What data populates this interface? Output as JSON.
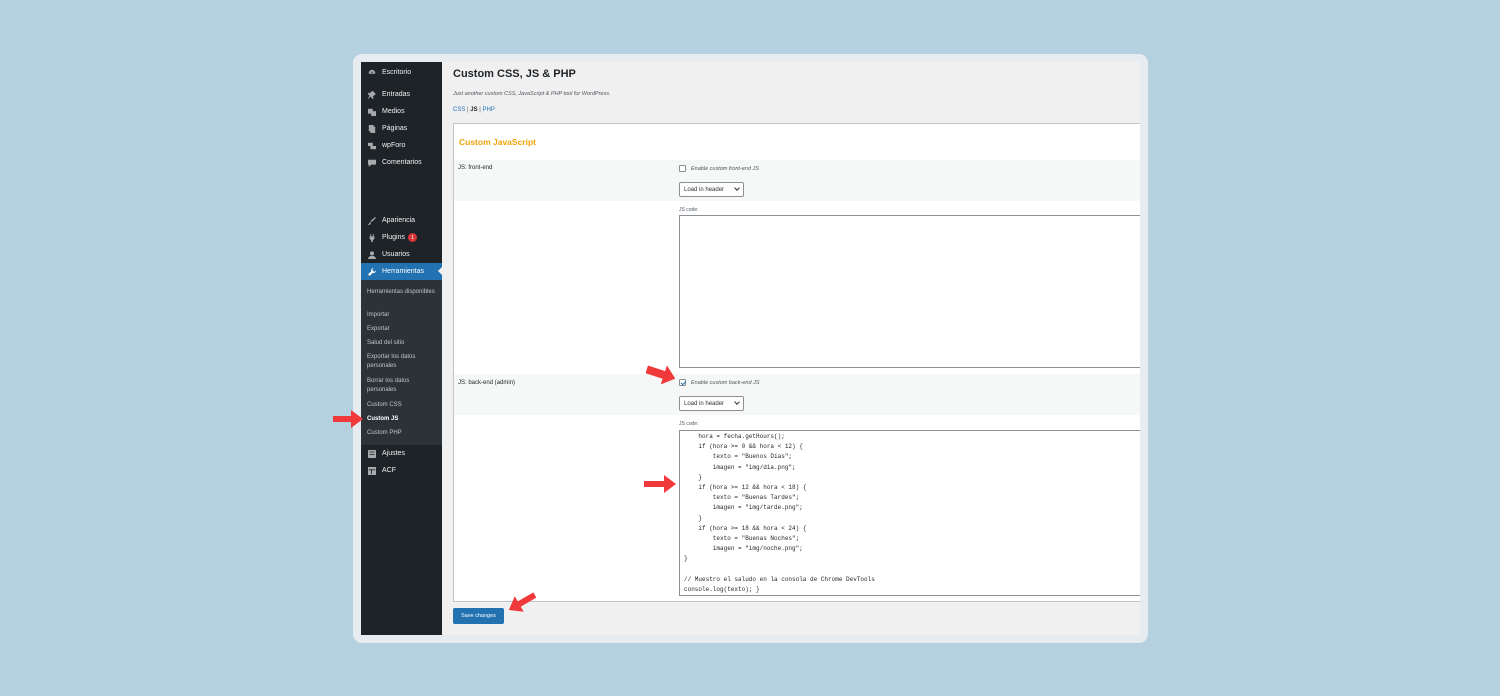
{
  "sidebar": {
    "items": [
      {
        "label": "Escritorio",
        "icon": "dashboard-icon"
      },
      {
        "label": "Entradas",
        "icon": "pin-icon"
      },
      {
        "label": "Medios",
        "icon": "media-icon"
      },
      {
        "label": "Páginas",
        "icon": "pages-icon"
      },
      {
        "label": "wpForo",
        "icon": "forum-icon"
      },
      {
        "label": "Comentarios",
        "icon": "comments-icon"
      },
      {
        "label": "Apariencia",
        "icon": "appearance-icon"
      },
      {
        "label": "Plugins",
        "icon": "plugins-icon",
        "badge": "1"
      },
      {
        "label": "Usuarios",
        "icon": "users-icon"
      },
      {
        "label": "Herramientas",
        "icon": "tools-icon"
      },
      {
        "label": "Ajustes",
        "icon": "settings-icon"
      },
      {
        "label": "ACF",
        "icon": "acf-icon"
      }
    ],
    "submenu": [
      "Herramientas disponibles",
      "Importar",
      "Exportar",
      "Salud del sitio",
      "Exportar los datos personales",
      "Borrar los datos personales",
      "Custom CSS",
      "Custom JS",
      "Custom PHP"
    ],
    "active_submenu": "Custom JS"
  },
  "page": {
    "title": "Custom CSS, JS & PHP",
    "description": "Just another custom CSS, JavaScript & PHP tool for WordPress.",
    "tabs": [
      "CSS",
      "JS",
      "PHP"
    ],
    "tab_separator": " | ",
    "current_tab": "JS"
  },
  "form": {
    "section_title": "Custom JavaScript",
    "front_end": {
      "label": "JS: front-end",
      "checkbox_label": "Enable custom front-end JS",
      "checked": false,
      "load_select": "Load in header",
      "code_label": "JS code:",
      "code": ""
    },
    "back_end": {
      "label": "JS: back-end (admin)",
      "checkbox_label": "Enable custom back-end JS",
      "checked": true,
      "load_select": "Load in header",
      "code_label": "JS code:",
      "code": "    hora = fecha.getHours();\n    if (hora >= 0 && hora < 12) {\n        texto = \"Buenos Días\";\n        imagen = \"img/dia.png\";\n    }\n    if (hora >= 12 && hora < 18) {\n        texto = \"Buenas Tardes\";\n        imagen = \"img/tarde.png\";\n    }\n    if (hora >= 18 && hora < 24) {\n        texto = \"Buenas Noches\";\n        imagen = \"img/noche.png\";\n}\n\n// Muestro el saludo en la consola de Chrome DevTools\nconsole.log(texto); }"
    },
    "save_label": "Save changes"
  },
  "colors": {
    "sidebar_bg": "#1d2327",
    "accent": "#2271b1",
    "section_title": "#f0a30a",
    "annotation_arrow": "#f0393b",
    "background": "#b5d1df"
  }
}
